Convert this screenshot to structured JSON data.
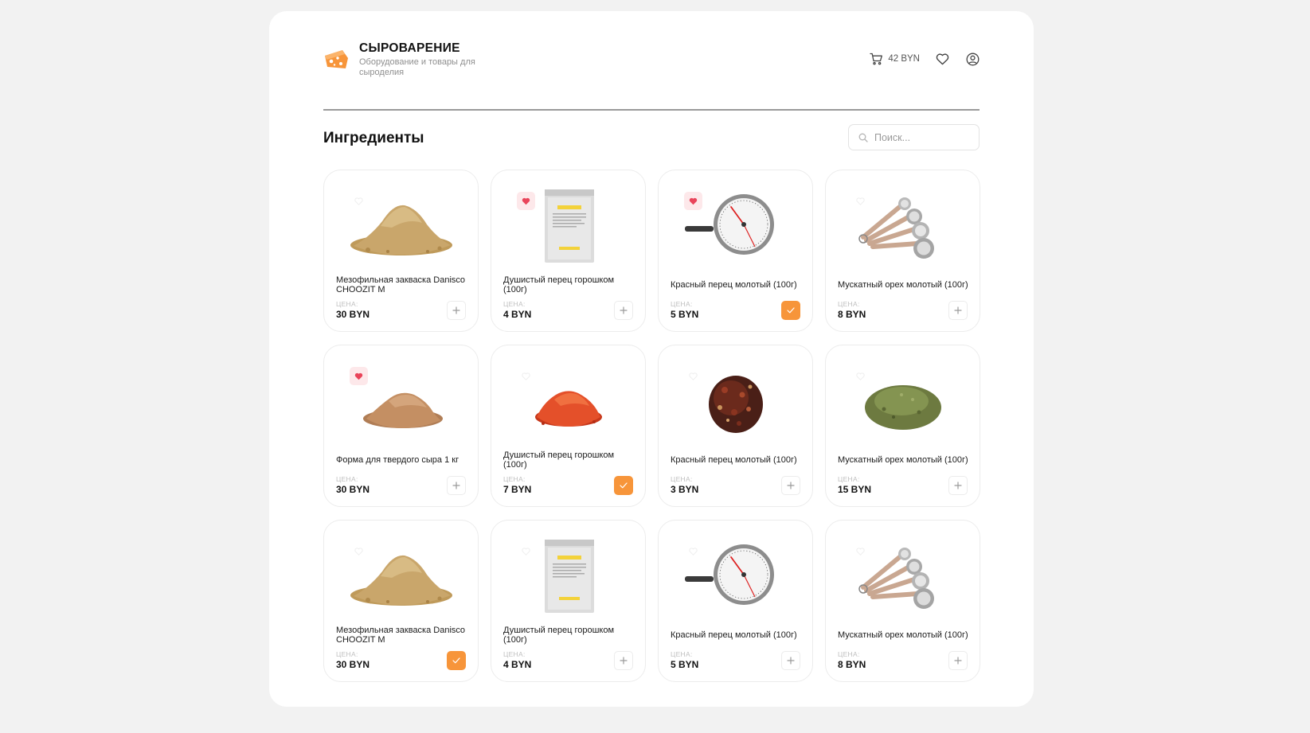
{
  "brand": {
    "title": "СЫРОВАРЕНИЕ",
    "subtitle": "Оборудование и товары для сыроделия",
    "accent": "#f7953a"
  },
  "header": {
    "cart_total": "42 BYN",
    "icons": [
      "cart-icon",
      "heart-icon",
      "user-icon"
    ]
  },
  "section": {
    "title": "Ингредиенты"
  },
  "search": {
    "placeholder": "Поиск..."
  },
  "price_label": "ЦЕНА:",
  "products": [
    {
      "name": "Мезофильная закваска Danisco CHOOZIT M",
      "price": "30 BYN",
      "favorite": false,
      "in_cart": false,
      "image": "powder-beige"
    },
    {
      "name": "Душистый перец горошком (100г)",
      "price": "4 BYN",
      "favorite": true,
      "in_cart": false,
      "image": "packet"
    },
    {
      "name": "Красный перец молотый (100г)",
      "price": "5 BYN",
      "favorite": true,
      "in_cart": true,
      "image": "thermometer"
    },
    {
      "name": "Мускатный орех молотый (100г)",
      "price": "8 BYN",
      "favorite": false,
      "in_cart": false,
      "image": "spoons"
    },
    {
      "name": "Форма для твердого сыра 1 кг",
      "price": "30 BYN",
      "favorite": true,
      "in_cart": false,
      "image": "powder-cinnamon"
    },
    {
      "name": "Душистый перец горошком (100г)",
      "price": "7 BYN",
      "favorite": false,
      "in_cart": true,
      "image": "powder-paprika"
    },
    {
      "name": "Красный перец молотый (100г)",
      "price": "3 BYN",
      "favorite": false,
      "in_cart": false,
      "image": "flakes-dark"
    },
    {
      "name": "Мускатный орех молотый (100г)",
      "price": "15 BYN",
      "favorite": false,
      "in_cart": false,
      "image": "herbs-green"
    },
    {
      "name": "Мезофильная закваска Danisco CHOOZIT M",
      "price": "30 BYN",
      "favorite": false,
      "in_cart": true,
      "image": "powder-beige"
    },
    {
      "name": "Душистый перец горошком (100г)",
      "price": "4 BYN",
      "favorite": false,
      "in_cart": false,
      "image": "packet"
    },
    {
      "name": "Красный перец молотый (100г)",
      "price": "5 BYN",
      "favorite": false,
      "in_cart": false,
      "image": "thermometer"
    },
    {
      "name": "Мускатный орех молотый (100г)",
      "price": "8 BYN",
      "favorite": false,
      "in_cart": false,
      "image": "spoons"
    }
  ]
}
